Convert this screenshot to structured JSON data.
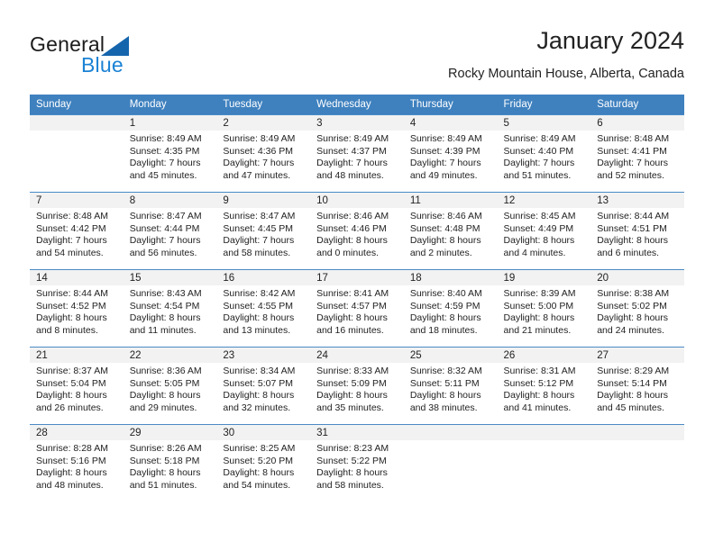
{
  "brand": {
    "name_part1": "General",
    "name_part2": "Blue",
    "triangle_color": "#1565ad",
    "blue_color": "#1b82d4"
  },
  "header": {
    "title": "January 2024",
    "location": "Rocky Mountain House, Alberta, Canada"
  },
  "calendar": {
    "header_bg": "#3f81bf",
    "header_text_color": "#ffffff",
    "daynum_bg": "#f2f2f2",
    "row_line_color": "#4a8ac4",
    "weekdays": [
      "Sunday",
      "Monday",
      "Tuesday",
      "Wednesday",
      "Thursday",
      "Friday",
      "Saturday"
    ],
    "weeks": [
      [
        {
          "day": "",
          "sunrise": "",
          "sunset": "",
          "daylight_line1": "",
          "daylight_line2": ""
        },
        {
          "day": "1",
          "sunrise": "Sunrise: 8:49 AM",
          "sunset": "Sunset: 4:35 PM",
          "daylight_line1": "Daylight: 7 hours",
          "daylight_line2": "and 45 minutes."
        },
        {
          "day": "2",
          "sunrise": "Sunrise: 8:49 AM",
          "sunset": "Sunset: 4:36 PM",
          "daylight_line1": "Daylight: 7 hours",
          "daylight_line2": "and 47 minutes."
        },
        {
          "day": "3",
          "sunrise": "Sunrise: 8:49 AM",
          "sunset": "Sunset: 4:37 PM",
          "daylight_line1": "Daylight: 7 hours",
          "daylight_line2": "and 48 minutes."
        },
        {
          "day": "4",
          "sunrise": "Sunrise: 8:49 AM",
          "sunset": "Sunset: 4:39 PM",
          "daylight_line1": "Daylight: 7 hours",
          "daylight_line2": "and 49 minutes."
        },
        {
          "day": "5",
          "sunrise": "Sunrise: 8:49 AM",
          "sunset": "Sunset: 4:40 PM",
          "daylight_line1": "Daylight: 7 hours",
          "daylight_line2": "and 51 minutes."
        },
        {
          "day": "6",
          "sunrise": "Sunrise: 8:48 AM",
          "sunset": "Sunset: 4:41 PM",
          "daylight_line1": "Daylight: 7 hours",
          "daylight_line2": "and 52 minutes."
        }
      ],
      [
        {
          "day": "7",
          "sunrise": "Sunrise: 8:48 AM",
          "sunset": "Sunset: 4:42 PM",
          "daylight_line1": "Daylight: 7 hours",
          "daylight_line2": "and 54 minutes."
        },
        {
          "day": "8",
          "sunrise": "Sunrise: 8:47 AM",
          "sunset": "Sunset: 4:44 PM",
          "daylight_line1": "Daylight: 7 hours",
          "daylight_line2": "and 56 minutes."
        },
        {
          "day": "9",
          "sunrise": "Sunrise: 8:47 AM",
          "sunset": "Sunset: 4:45 PM",
          "daylight_line1": "Daylight: 7 hours",
          "daylight_line2": "and 58 minutes."
        },
        {
          "day": "10",
          "sunrise": "Sunrise: 8:46 AM",
          "sunset": "Sunset: 4:46 PM",
          "daylight_line1": "Daylight: 8 hours",
          "daylight_line2": "and 0 minutes."
        },
        {
          "day": "11",
          "sunrise": "Sunrise: 8:46 AM",
          "sunset": "Sunset: 4:48 PM",
          "daylight_line1": "Daylight: 8 hours",
          "daylight_line2": "and 2 minutes."
        },
        {
          "day": "12",
          "sunrise": "Sunrise: 8:45 AM",
          "sunset": "Sunset: 4:49 PM",
          "daylight_line1": "Daylight: 8 hours",
          "daylight_line2": "and 4 minutes."
        },
        {
          "day": "13",
          "sunrise": "Sunrise: 8:44 AM",
          "sunset": "Sunset: 4:51 PM",
          "daylight_line1": "Daylight: 8 hours",
          "daylight_line2": "and 6 minutes."
        }
      ],
      [
        {
          "day": "14",
          "sunrise": "Sunrise: 8:44 AM",
          "sunset": "Sunset: 4:52 PM",
          "daylight_line1": "Daylight: 8 hours",
          "daylight_line2": "and 8 minutes."
        },
        {
          "day": "15",
          "sunrise": "Sunrise: 8:43 AM",
          "sunset": "Sunset: 4:54 PM",
          "daylight_line1": "Daylight: 8 hours",
          "daylight_line2": "and 11 minutes."
        },
        {
          "day": "16",
          "sunrise": "Sunrise: 8:42 AM",
          "sunset": "Sunset: 4:55 PM",
          "daylight_line1": "Daylight: 8 hours",
          "daylight_line2": "and 13 minutes."
        },
        {
          "day": "17",
          "sunrise": "Sunrise: 8:41 AM",
          "sunset": "Sunset: 4:57 PM",
          "daylight_line1": "Daylight: 8 hours",
          "daylight_line2": "and 16 minutes."
        },
        {
          "day": "18",
          "sunrise": "Sunrise: 8:40 AM",
          "sunset": "Sunset: 4:59 PM",
          "daylight_line1": "Daylight: 8 hours",
          "daylight_line2": "and 18 minutes."
        },
        {
          "day": "19",
          "sunrise": "Sunrise: 8:39 AM",
          "sunset": "Sunset: 5:00 PM",
          "daylight_line1": "Daylight: 8 hours",
          "daylight_line2": "and 21 minutes."
        },
        {
          "day": "20",
          "sunrise": "Sunrise: 8:38 AM",
          "sunset": "Sunset: 5:02 PM",
          "daylight_line1": "Daylight: 8 hours",
          "daylight_line2": "and 24 minutes."
        }
      ],
      [
        {
          "day": "21",
          "sunrise": "Sunrise: 8:37 AM",
          "sunset": "Sunset: 5:04 PM",
          "daylight_line1": "Daylight: 8 hours",
          "daylight_line2": "and 26 minutes."
        },
        {
          "day": "22",
          "sunrise": "Sunrise: 8:36 AM",
          "sunset": "Sunset: 5:05 PM",
          "daylight_line1": "Daylight: 8 hours",
          "daylight_line2": "and 29 minutes."
        },
        {
          "day": "23",
          "sunrise": "Sunrise: 8:34 AM",
          "sunset": "Sunset: 5:07 PM",
          "daylight_line1": "Daylight: 8 hours",
          "daylight_line2": "and 32 minutes."
        },
        {
          "day": "24",
          "sunrise": "Sunrise: 8:33 AM",
          "sunset": "Sunset: 5:09 PM",
          "daylight_line1": "Daylight: 8 hours",
          "daylight_line2": "and 35 minutes."
        },
        {
          "day": "25",
          "sunrise": "Sunrise: 8:32 AM",
          "sunset": "Sunset: 5:11 PM",
          "daylight_line1": "Daylight: 8 hours",
          "daylight_line2": "and 38 minutes."
        },
        {
          "day": "26",
          "sunrise": "Sunrise: 8:31 AM",
          "sunset": "Sunset: 5:12 PM",
          "daylight_line1": "Daylight: 8 hours",
          "daylight_line2": "and 41 minutes."
        },
        {
          "day": "27",
          "sunrise": "Sunrise: 8:29 AM",
          "sunset": "Sunset: 5:14 PM",
          "daylight_line1": "Daylight: 8 hours",
          "daylight_line2": "and 45 minutes."
        }
      ],
      [
        {
          "day": "28",
          "sunrise": "Sunrise: 8:28 AM",
          "sunset": "Sunset: 5:16 PM",
          "daylight_line1": "Daylight: 8 hours",
          "daylight_line2": "and 48 minutes."
        },
        {
          "day": "29",
          "sunrise": "Sunrise: 8:26 AM",
          "sunset": "Sunset: 5:18 PM",
          "daylight_line1": "Daylight: 8 hours",
          "daylight_line2": "and 51 minutes."
        },
        {
          "day": "30",
          "sunrise": "Sunrise: 8:25 AM",
          "sunset": "Sunset: 5:20 PM",
          "daylight_line1": "Daylight: 8 hours",
          "daylight_line2": "and 54 minutes."
        },
        {
          "day": "31",
          "sunrise": "Sunrise: 8:23 AM",
          "sunset": "Sunset: 5:22 PM",
          "daylight_line1": "Daylight: 8 hours",
          "daylight_line2": "and 58 minutes."
        },
        {
          "day": "",
          "sunrise": "",
          "sunset": "",
          "daylight_line1": "",
          "daylight_line2": ""
        },
        {
          "day": "",
          "sunrise": "",
          "sunset": "",
          "daylight_line1": "",
          "daylight_line2": ""
        },
        {
          "day": "",
          "sunrise": "",
          "sunset": "",
          "daylight_line1": "",
          "daylight_line2": ""
        }
      ]
    ]
  }
}
